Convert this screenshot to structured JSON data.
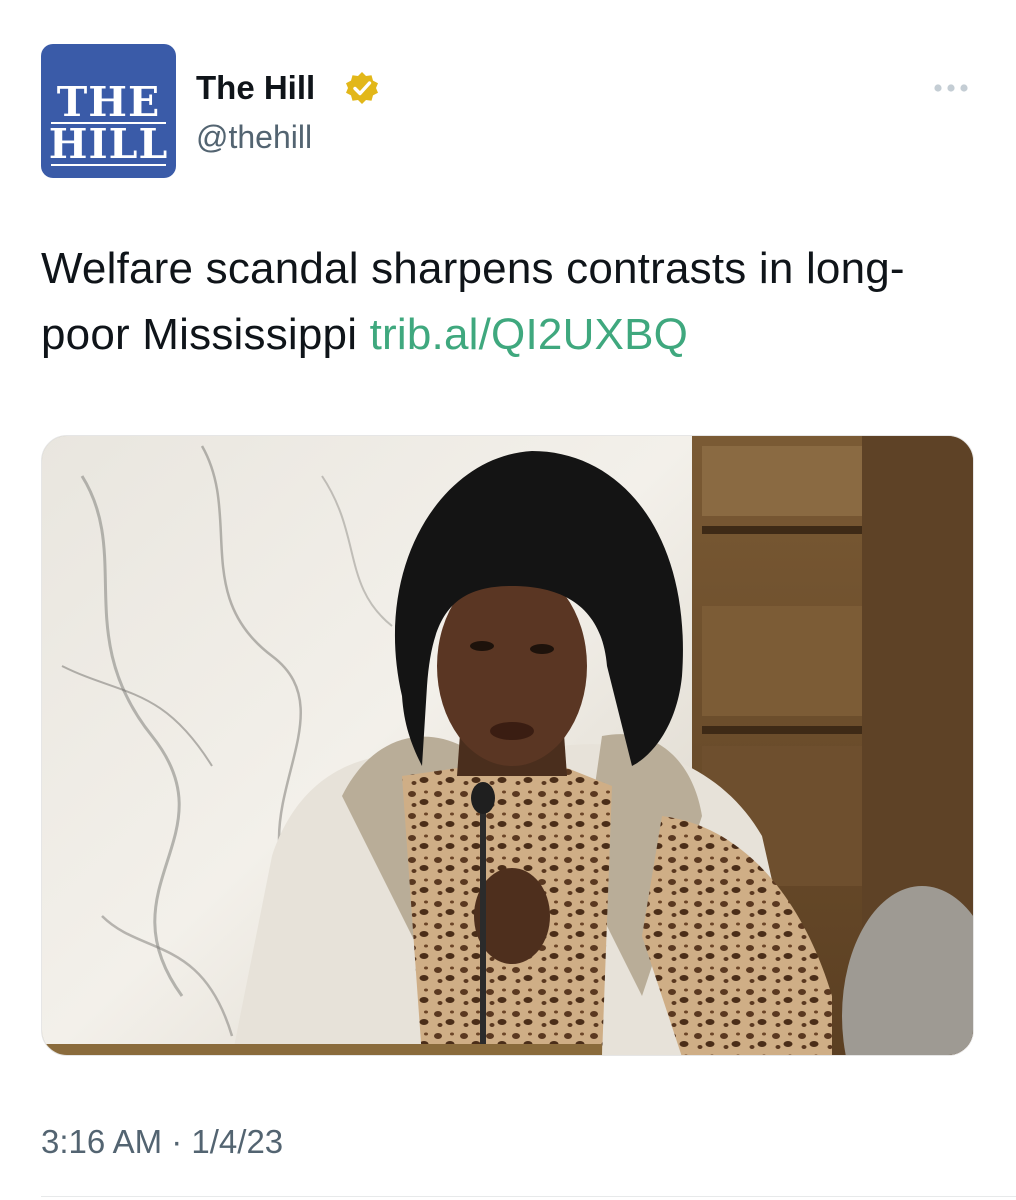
{
  "author": {
    "avatar_logo_line1": "THE",
    "avatar_logo_line2": "HILL",
    "name": "The Hill",
    "handle": "@thehill",
    "verified_icon": "gold-verified-badge-icon",
    "more_icon": "more-horizontal-icon"
  },
  "tweet": {
    "text": "Welfare scandal sharpens contrasts in long-poor Mississippi",
    "link": "trib.al/QI2UXBQ"
  },
  "media": {
    "icon": "photo-woman-speaking-at-microphone"
  },
  "timestamp": {
    "time": "3:16 AM",
    "separator": " · ",
    "date": "1/4/23"
  },
  "colors": {
    "avatar_bg": "#3a5ba8",
    "link": "#3fa87e",
    "verified_badge": "#e2b719",
    "secondary_text": "#536471"
  }
}
